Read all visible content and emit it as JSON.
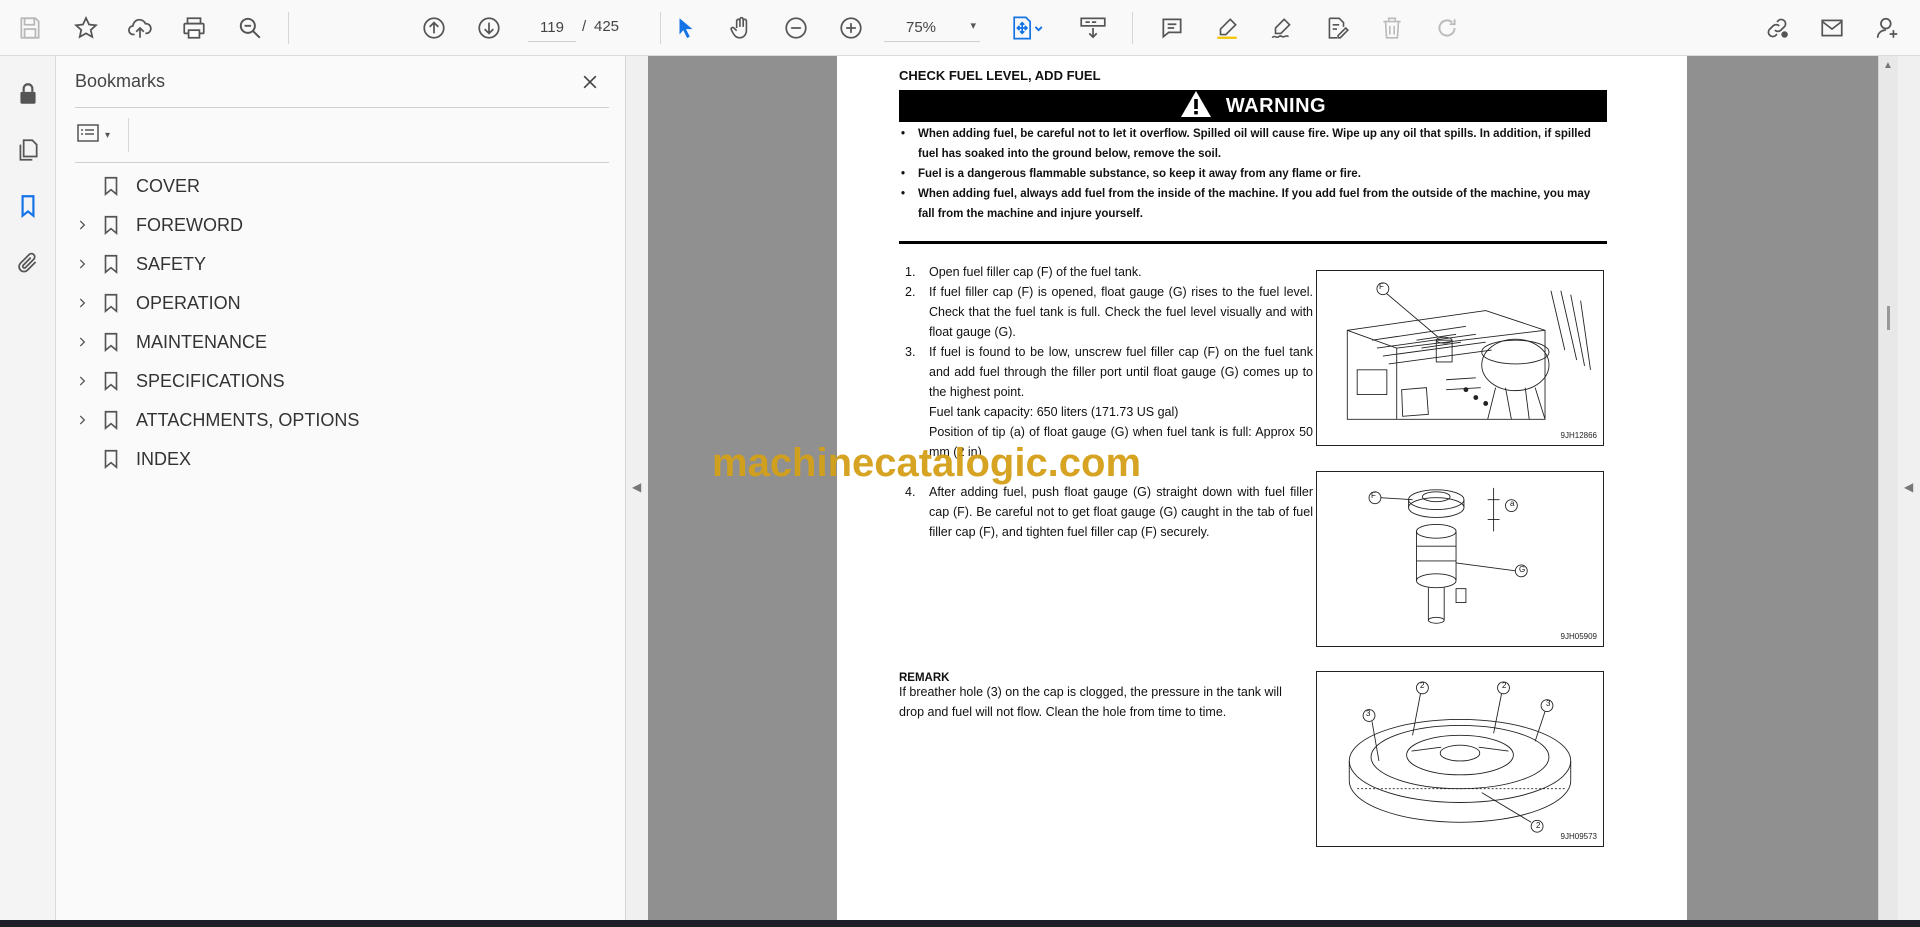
{
  "toolbar": {
    "current_page": "119",
    "page_separator": "/",
    "total_pages": "425",
    "zoom": "75%",
    "zoom_caret": "▾"
  },
  "bookmarks": {
    "title": "Bookmarks",
    "items": [
      {
        "label": "COVER",
        "expandable": false
      },
      {
        "label": "FOREWORD",
        "expandable": true
      },
      {
        "label": "SAFETY",
        "expandable": true
      },
      {
        "label": "OPERATION",
        "expandable": true
      },
      {
        "label": "MAINTENANCE",
        "expandable": true
      },
      {
        "label": "SPECIFICATIONS",
        "expandable": true
      },
      {
        "label": "ATTACHMENTS, OPTIONS",
        "expandable": true
      },
      {
        "label": "INDEX",
        "expandable": false
      }
    ]
  },
  "document": {
    "section_title": "CHECK FUEL LEVEL, ADD FUEL",
    "warning_label": "WARNING",
    "warning_bullet": "•",
    "warnings": [
      "When adding fuel, be careful not to let it overflow.  Spilled oil will cause fire.  Wipe up any oil that spills.  In addition, if spilled fuel has soaked into the ground below, remove the soil.",
      "Fuel is a dangerous flammable substance, so keep it away from any flame or fire.",
      "When adding fuel, always add fuel from the inside of the machine.  If you add fuel from the outside of the machine, you may fall from the machine and injure yourself."
    ],
    "steps": [
      {
        "num": "1.",
        "text": "Open fuel filler cap (F) of the fuel tank."
      },
      {
        "num": "2.",
        "text": "If fuel filler cap (F) is opened, float gauge (G) rises to the fuel level.  Check that the fuel tank is full. Check the fuel level visually and with float gauge (G)."
      },
      {
        "num": "3.",
        "text": "If fuel is found to be low, unscrew fuel filler cap (F) on the fuel tank and add fuel through the filler port until float gauge (G) comes up to the highest point."
      },
      {
        "num": "4.",
        "text": "After adding fuel, push float gauge (G) straight down with fuel filler cap (F). Be careful not to get float gauge (G) caught in the tab of fuel filler cap (F), and tighten fuel filler cap (F) securely."
      }
    ],
    "capacity": "Fuel tank capacity: 650 liters (171.73 US gal)",
    "tip_position": "Position of tip (a) of float gauge (G) when fuel tank is full: Approx 50 mm (2 in)",
    "figures": [
      {
        "code": "9JH12866",
        "labels": [
          "F"
        ]
      },
      {
        "code": "9JH05909",
        "labels": [
          "F",
          "a",
          "G"
        ]
      },
      {
        "code": "9JH09573",
        "labels": [
          "2",
          "2",
          "3",
          "3",
          "2"
        ]
      }
    ],
    "remark_title": "REMARK",
    "remark_text": "If breather hole (3) on the cap is clogged, the pressure in the tank will drop and fuel will not flow.  Clean the hole from time to time.",
    "watermark": "machinecatalogic.com"
  }
}
